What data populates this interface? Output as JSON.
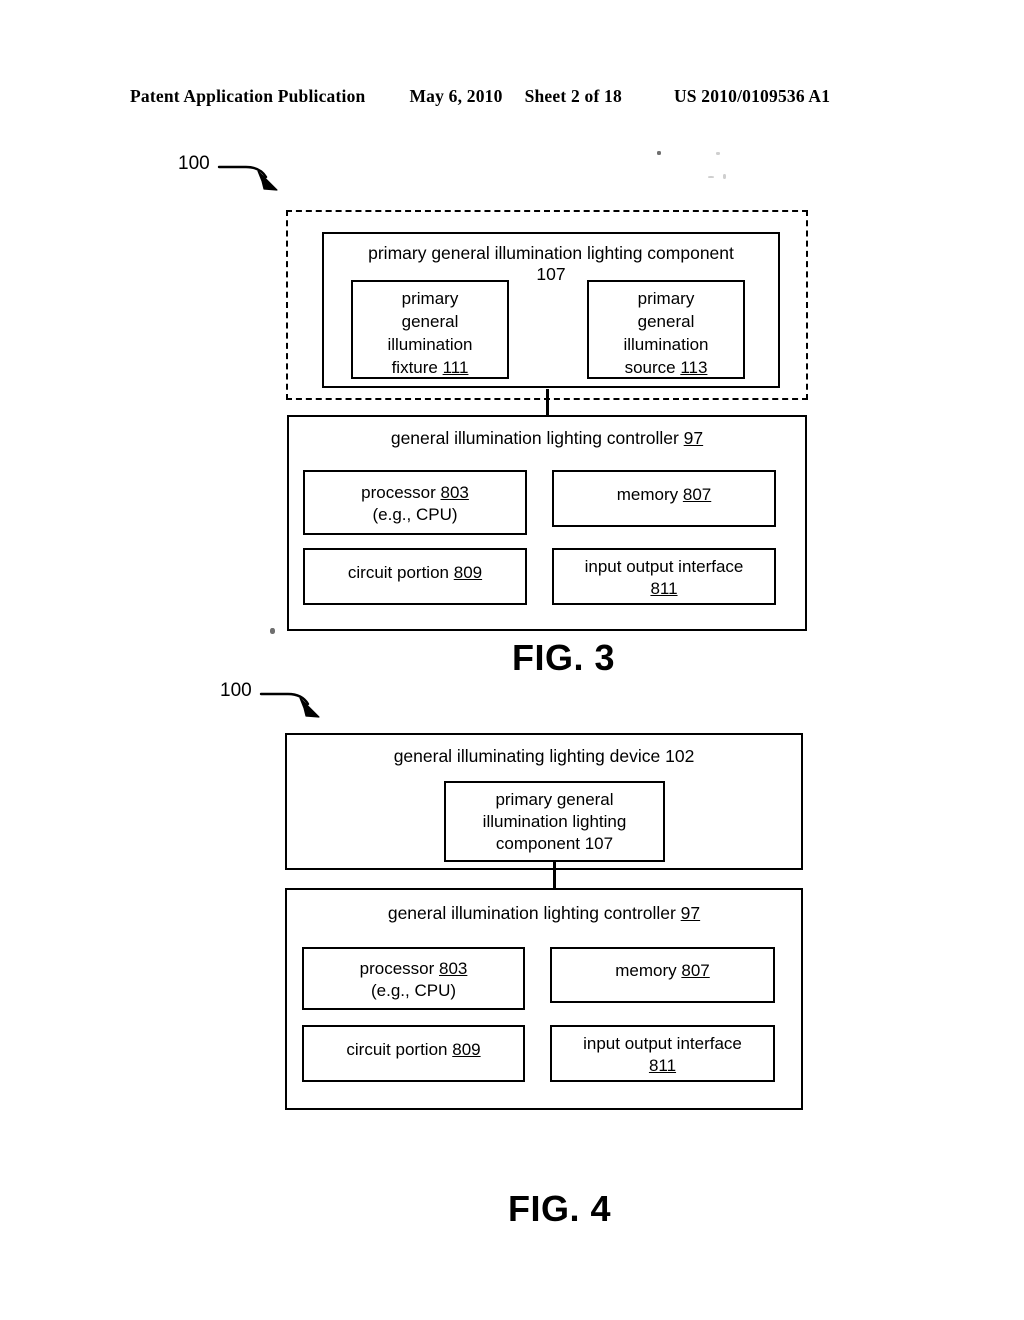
{
  "header": {
    "publication": "Patent Application Publication",
    "date": "May 6, 2010",
    "sheet": "Sheet 2 of 18",
    "number": "US 2010/0109536 A1"
  },
  "figures": [
    {
      "id": "fig3",
      "caption": "FIG. 3",
      "callout": "100",
      "dashed_group": {
        "name": "primary general illumination lighting component group",
        "inner_box": {
          "title_line1": "primary general illumination lighting component",
          "title_line2": "107",
          "children": [
            {
              "lines": [
                "primary",
                "general",
                "illumination"
              ],
              "label": "fixture",
              "ref": "111"
            },
            {
              "lines": [
                "primary",
                "general",
                "illumination"
              ],
              "label": "source",
              "ref": "113"
            }
          ]
        }
      },
      "controller": {
        "title": "general illumination lighting controller",
        "title_ref": "97",
        "blocks": [
          {
            "label": "processor",
            "ref": "803",
            "sub": "(e.g., CPU)"
          },
          {
            "label": "memory",
            "ref": "807",
            "sub": ""
          },
          {
            "label": "circuit portion",
            "ref": "809",
            "sub": ""
          },
          {
            "label": "input output interface",
            "ref": "811",
            "sub": ""
          }
        ]
      }
    },
    {
      "id": "fig4",
      "caption": "FIG. 4",
      "callout": "100",
      "device": {
        "title": "general illuminating lighting device 102",
        "inner_box": {
          "line1": "primary general",
          "line2": "illumination lighting",
          "line3": "component 107"
        }
      },
      "controller": {
        "title": "general illumination lighting controller",
        "title_ref": "97",
        "blocks": [
          {
            "label": "processor",
            "ref": "803",
            "sub": "(e.g., CPU)"
          },
          {
            "label": "memory",
            "ref": "807",
            "sub": ""
          },
          {
            "label": "circuit portion",
            "ref": "809",
            "sub": ""
          },
          {
            "label": "input output interface",
            "ref": "811",
            "sub": ""
          }
        ]
      }
    }
  ],
  "colors": {
    "ink": "#000000",
    "paper": "#ffffff"
  }
}
